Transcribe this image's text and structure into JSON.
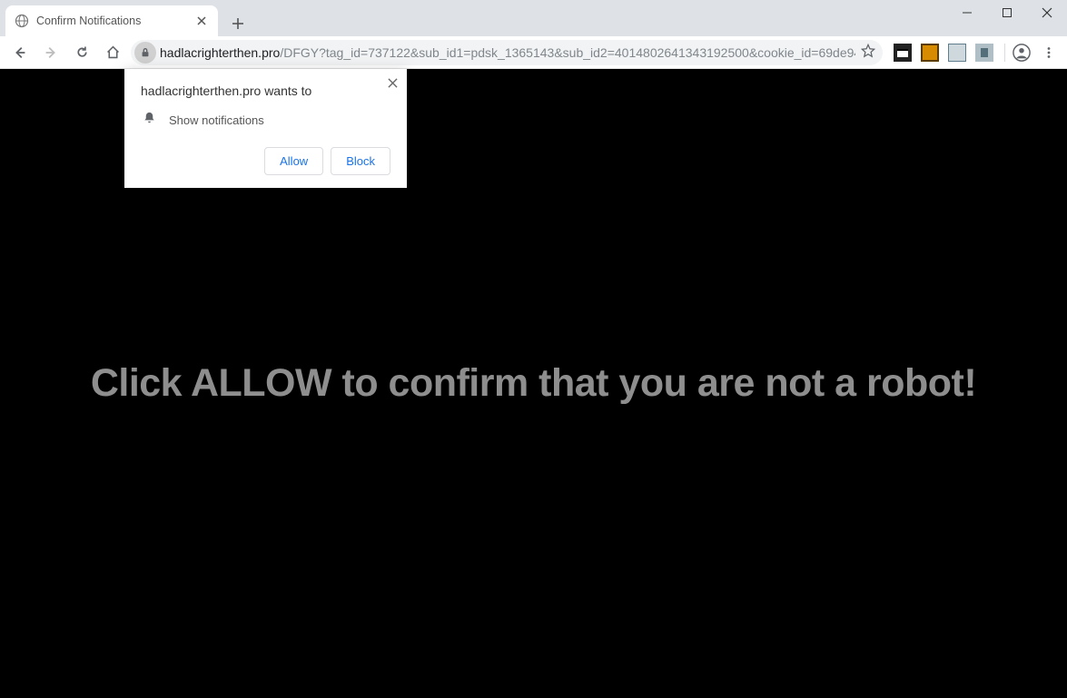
{
  "window": {
    "min": "–",
    "max": "☐",
    "close": "✕"
  },
  "tab": {
    "title": "Confirm Notifications"
  },
  "url": {
    "domain": "hadlacrighterthen.pro",
    "path": "/DFGY?tag_id=737122&sub_id1=pdsk_1365143&sub_id2=4014802641343192500&cookie_id=69de94…"
  },
  "perm": {
    "title": "hadlacrighterthen.pro wants to",
    "row": "Show notifications",
    "allow": "Allow",
    "block": "Block"
  },
  "page": {
    "message": "Click ALLOW to confirm that you are not a robot!"
  }
}
